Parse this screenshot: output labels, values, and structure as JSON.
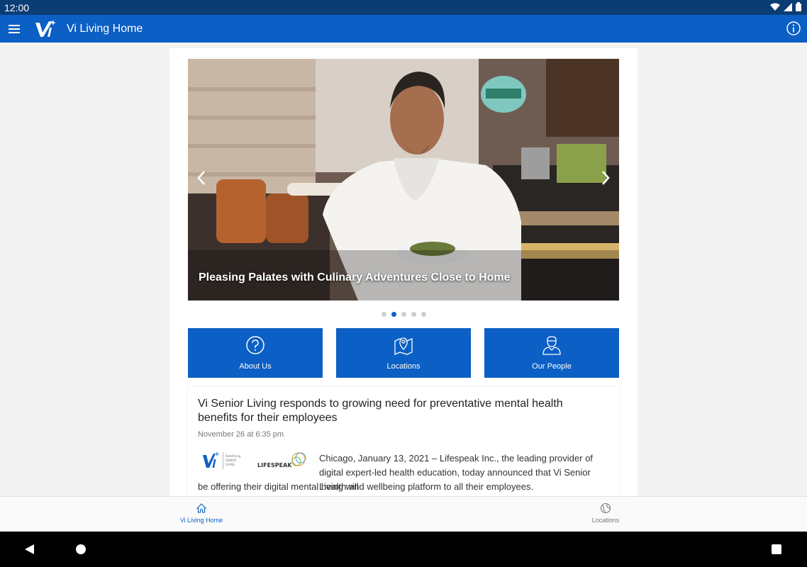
{
  "status_bar": {
    "time": "12:00"
  },
  "app_bar": {
    "title": "Vi Living Home"
  },
  "carousel": {
    "caption": "Pleasing Palates with Culinary Adventures Close to Home",
    "slide_count": 5,
    "active_slide": 2
  },
  "tiles": [
    {
      "label": "About Us",
      "icon": "help-circle-icon"
    },
    {
      "label": "Locations",
      "icon": "map-pin-icon"
    },
    {
      "label": "Our People",
      "icon": "person-icon"
    }
  ],
  "article": {
    "headline": "Vi Senior Living responds to growing need for preventative mental health benefits for their employees",
    "date": "November 26 at 6:35 pm",
    "logo_text_1": "Redefining SENIOR LIVING",
    "logo_text_2": "LIFESPEAK",
    "body_line_1": "Chicago, January 13, 2021 – Lifespeak Inc., the leading provider of digital expert-led health education, today announced that Vi Senior Living will",
    "body_line_2": "be offering their digital mental health and wellbeing platform to all their employees."
  },
  "bottom_nav": {
    "items": [
      {
        "label": "Vi Living Home",
        "icon": "home-icon",
        "active": true
      },
      {
        "label": "Locations",
        "icon": "globe-icon",
        "active": false
      }
    ]
  },
  "colors": {
    "brand": "#0c5fc4",
    "status_bar": "#0b3d75"
  }
}
